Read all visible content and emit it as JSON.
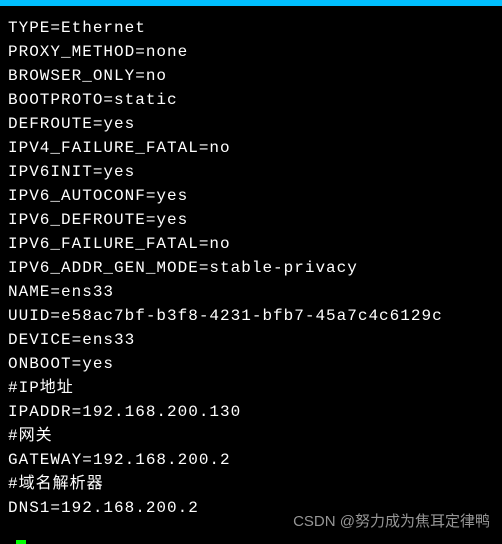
{
  "config_lines": [
    "TYPE=Ethernet",
    "PROXY_METHOD=none",
    "BROWSER_ONLY=no",
    "BOOTPROTO=static",
    "DEFROUTE=yes",
    "IPV4_FAILURE_FATAL=no",
    "IPV6INIT=yes",
    "IPV6_AUTOCONF=yes",
    "IPV6_DEFROUTE=yes",
    "IPV6_FAILURE_FATAL=no",
    "IPV6_ADDR_GEN_MODE=stable-privacy",
    "NAME=ens33",
    "UUID=e58ac7bf-b3f8-4231-bfb7-45a7c4c6129c",
    "DEVICE=ens33",
    "ONBOOT=yes",
    "#IP地址",
    "IPADDR=192.168.200.130",
    "#网关",
    "GATEWAY=192.168.200.2",
    "#域名解析器",
    "DNS1=192.168.200.2"
  ],
  "watermark": "CSDN @努力成为焦耳定律鸭"
}
